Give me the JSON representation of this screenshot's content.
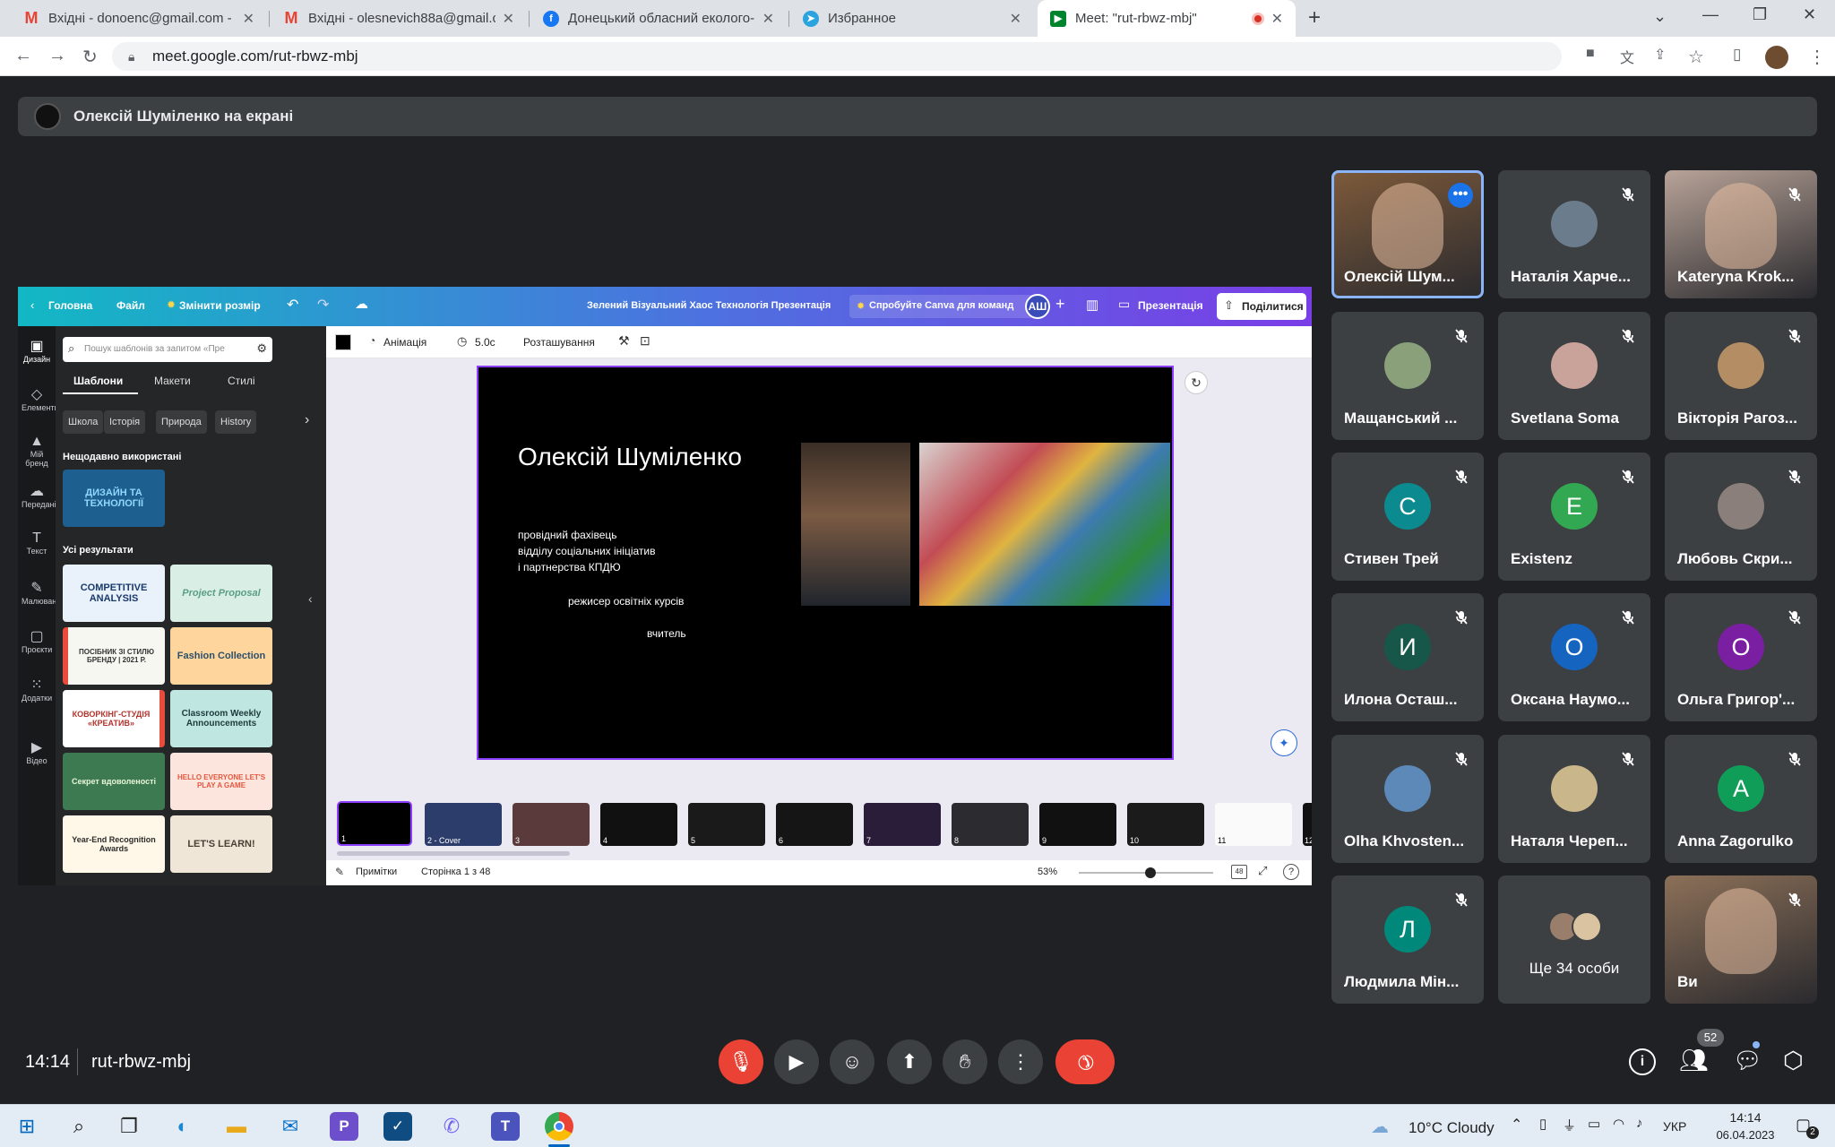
{
  "browser": {
    "tabs": [
      {
        "title": "Вхідні - donoenc@gmail.com - G",
        "icon": "gmail-icon"
      },
      {
        "title": "Вхідні - olesnevich88a@gmail.co",
        "icon": "gmail-icon"
      },
      {
        "title": "Донецький обласний еколого-",
        "icon": "facebook-icon"
      },
      {
        "title": "Избранное",
        "icon": "telegram-icon"
      },
      {
        "title": "Meet: \"rut-rbwz-mbj\"",
        "icon": "meet-icon"
      }
    ],
    "url": "meet.google.com/rut-rbwz-mbj"
  },
  "meet": {
    "presenting_text": "Олексій Шуміленко на екрані",
    "time": "14:14",
    "code": "rut-rbwz-mbj",
    "people_count": "52",
    "more_people": "Ще 34 особи",
    "participants": [
      {
        "name": "Олексій Шум...",
        "avatar": "",
        "color": "#7e5a3a",
        "video": true,
        "speaking": true
      },
      {
        "name": "Наталія Харче...",
        "avatar": "",
        "color": "#6b7d8c"
      },
      {
        "name": "Kateryna Krok...",
        "avatar": "",
        "color": "#b8a398",
        "video": true
      },
      {
        "name": "Мащанський ...",
        "avatar": "",
        "color": "#8aa07a"
      },
      {
        "name": "Svetlana Soma",
        "avatar": "",
        "color": "#c9a39a"
      },
      {
        "name": "Вікторія Рагоз...",
        "avatar": "",
        "color": "#b58d64"
      },
      {
        "name": "Стивен Трей",
        "avatar": "С",
        "color": "#0b8a90"
      },
      {
        "name": "Existenz",
        "avatar": "E",
        "color": "#33a852"
      },
      {
        "name": "Любовь Скри...",
        "avatar": "",
        "color": "#8a7f7a"
      },
      {
        "name": "Илона Осташ...",
        "avatar": "И",
        "color": "#17574a"
      },
      {
        "name": "Оксана Наумо...",
        "avatar": "О",
        "color": "#1565c0"
      },
      {
        "name": "Ольга Григор'...",
        "avatar": "О",
        "color": "#7b1fa2"
      },
      {
        "name": "Olha Khvosten...",
        "avatar": "",
        "color": "#5d89b8"
      },
      {
        "name": "Наталя Череп...",
        "avatar": "",
        "color": "#c9b68a"
      },
      {
        "name": "Anna Zagorulko",
        "avatar": "A",
        "color": "#0f9d58"
      },
      {
        "name": "Людмила Мін...",
        "avatar": "Л",
        "color": "#00897b"
      },
      {
        "name": "Ви",
        "avatar": "",
        "color": "#8c7058",
        "video": true
      }
    ]
  },
  "canva": {
    "menu": {
      "home": "Головна",
      "file": "Файл",
      "resize": "Змінити розмір"
    },
    "doc_title": "Зелений Візуальний Хаос Технологія Презентація",
    "try_teams": "Спробуйте Canva для команд",
    "avatar_initials": "АШ",
    "present": "Презентація",
    "share": "Поділитися",
    "sidebar": [
      "Дизайн",
      "Елементи",
      "Мій бренд",
      "Передані",
      "Текст",
      "Малювання",
      "Проєкти",
      "Додатки",
      "Відео"
    ],
    "search_placeholder": "Пошук шаблонів за запитом «Пре",
    "panel_tabs": [
      "Шаблони",
      "Макети",
      "Стилі"
    ],
    "chips": [
      "Школа",
      "Історія",
      "Природа",
      "History"
    ],
    "recent_heading": "Нещодавно використані",
    "recent_thumb": "ДИЗАЙН ТА ТЕХНОЛОГІЇ",
    "results_heading": "Усі результати",
    "templates": [
      "COMPETITIVE ANALYSIS",
      "Project Proposal",
      "ПОСІБНИК ЗІ СТИЛЮ БРЕНДУ | 2021 Р.",
      "Fashion Collection",
      "КОВОРКІНГ-СТУДІЯ «КРЕАТИВ»",
      "Classroom Weekly Announcements",
      "Секрет вдоволеності",
      "HELLO EVERYONE LET'S PLAY A GAME",
      "Year-End Recognition Awards",
      "LET'S LEARN!"
    ],
    "toolbar": {
      "animation": "Анімація",
      "duration": "5.0с",
      "position": "Розташування"
    },
    "slide": {
      "name": "Олексій Шуміленко",
      "role_lines": [
        "провідний фахівець",
        "відділу соціальних ініціатив",
        "і партнерства КПДЮ"
      ],
      "role2": "режисер освітніх курсів",
      "role3": "вчитель"
    },
    "strip": [
      {
        "num": "1"
      },
      {
        "num": "2 - Cover"
      },
      {
        "num": "3"
      },
      {
        "num": "4"
      },
      {
        "num": "5"
      },
      {
        "num": "6"
      },
      {
        "num": "7"
      },
      {
        "num": "8"
      },
      {
        "num": "9"
      },
      {
        "num": "10"
      },
      {
        "num": "11"
      },
      {
        "num": "12"
      }
    ],
    "notes": "Примітки",
    "page_info": "Сторінка 1 з 48",
    "zoom": "53%",
    "zoom_fraction": 0.53,
    "grid_count": "48"
  },
  "taskbar": {
    "weather": "10°C  Cloudy",
    "lang": "УКР",
    "time": "14:14",
    "date": "06.04.2023",
    "notif": "2"
  }
}
